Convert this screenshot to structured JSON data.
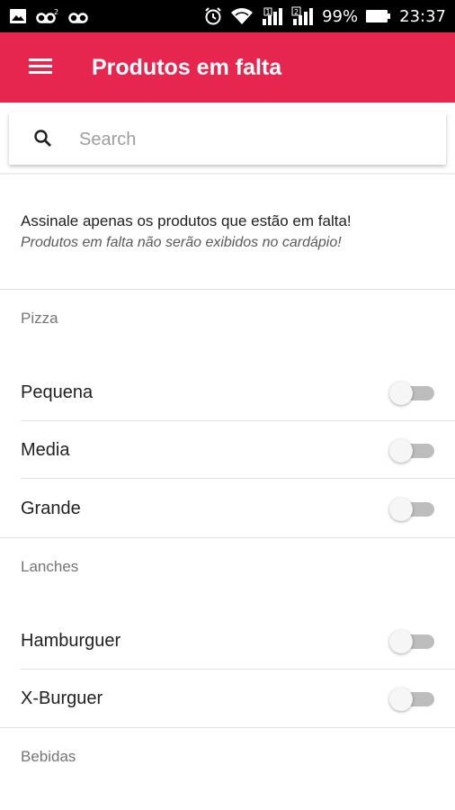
{
  "status_bar": {
    "battery_percent": "99%",
    "time": "23:37",
    "icons": [
      "image-icon",
      "voicemail-icon",
      "voicemail-icon",
      "alarm-icon",
      "wifi-icon",
      "signal-icon",
      "signal-icon",
      "battery-icon"
    ]
  },
  "toolbar": {
    "title": "Produtos em falta",
    "menu_icon": "menu-icon",
    "color": "#e6264f"
  },
  "search": {
    "placeholder": "Search",
    "value": ""
  },
  "notice": {
    "line1": "Assinale apenas os produtos que estão em falta!",
    "line2": "Produtos em falta não serão exibidos no cardápio!"
  },
  "sections": [
    {
      "title": "Pizza",
      "items": [
        {
          "label": "Pequena",
          "checked": false
        },
        {
          "label": "Media",
          "checked": false
        },
        {
          "label": "Grande",
          "checked": false
        }
      ]
    },
    {
      "title": "Lanches",
      "items": [
        {
          "label": "Hamburguer",
          "checked": false
        },
        {
          "label": "X-Burguer",
          "checked": false
        }
      ]
    },
    {
      "title": "Bebidas",
      "items": []
    }
  ]
}
